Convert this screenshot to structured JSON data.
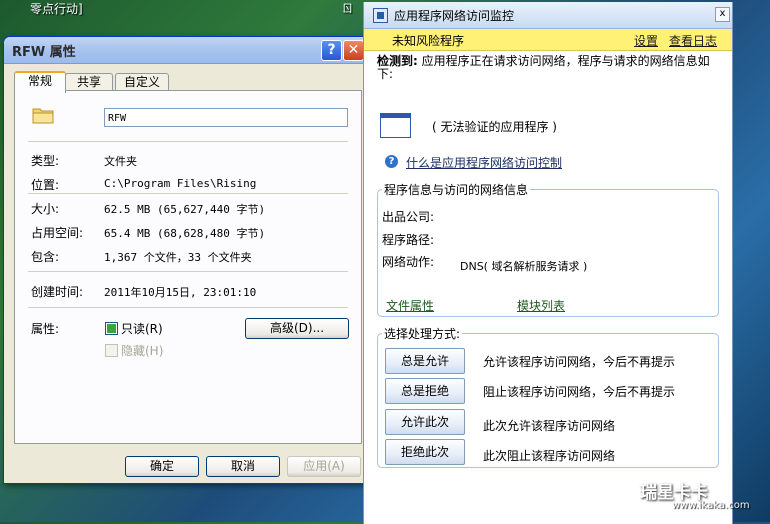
{
  "desktop": {
    "text_left": "零点行动]",
    "text_right": "ㄖ"
  },
  "properties": {
    "title": "RFW 属性",
    "help_glyph": "?",
    "close_glyph": "✕",
    "tabs": [
      {
        "label": "常规",
        "active": true
      },
      {
        "label": "共享",
        "active": false
      },
      {
        "label": "自定义",
        "active": false
      }
    ],
    "name_value": "RFW",
    "rows": {
      "type_label": "类型:",
      "type_value": "文件夹",
      "location_label": "位置:",
      "location_value": "C:\\Program Files\\Rising",
      "size_label": "大小:",
      "size_value": "62.5 MB (65,627,440 字节)",
      "disk_label": "占用空间:",
      "disk_value": "65.4 MB (68,628,480 字节)",
      "contains_label": "包含:",
      "contains_value": "1,367 个文件，33 个文件夹",
      "created_label": "创建时间:",
      "created_value": "2011年10月15日, 23:01:10",
      "attr_label": "属性:"
    },
    "attributes": {
      "readonly_label": "只读(R)",
      "readonly_checked": true,
      "hidden_label": "隐藏(H)",
      "hidden_checked": false,
      "advanced_button": "高级(D)..."
    },
    "buttons": {
      "ok": "确定",
      "cancel": "取消",
      "apply": "应用(A)"
    }
  },
  "monitor": {
    "title": "应用程序网络访问监控",
    "close_glyph": "x",
    "warning_title": "未知风险程序",
    "settings_link": "设置",
    "log_link": "查看日志",
    "detected_label": "检测到:",
    "detected_text": "应用程序正在请求访问网络，程序与请求的网络信息如下:",
    "app_name": "( 无法验证的应用程序 )",
    "help_link": "什么是应用程序网络访问控制",
    "info_group": {
      "title": "程序信息与访问的网络信息",
      "publisher_label": "出品公司:",
      "publisher_value": "",
      "path_label": "程序路径:",
      "path_value": "",
      "action_label": "网络动作:",
      "action_value": "DNS( 域名解析服务请求 )",
      "file_props_link": "文件属性",
      "modules_link": "模块列表"
    },
    "action_group": {
      "title": "选择处理方式:",
      "actions": [
        {
          "button": "总是允许",
          "desc": "允许该程序访问网络，今后不再提示"
        },
        {
          "button": "总是拒绝",
          "desc": "阻止该程序访问网络，今后不再提示"
        },
        {
          "button": "允许此次",
          "desc": "此次允许该程序访问网络"
        },
        {
          "button": "拒绝此次",
          "desc": "此次阻止该程序访问网络"
        }
      ]
    }
  },
  "watermark": {
    "brand": "瑞星卡卡",
    "url": "www.ikaka.com"
  },
  "colors": {
    "warning_bar": "#fff176",
    "xp_title": "#0831d9",
    "link_green": "#1f5a1f"
  }
}
